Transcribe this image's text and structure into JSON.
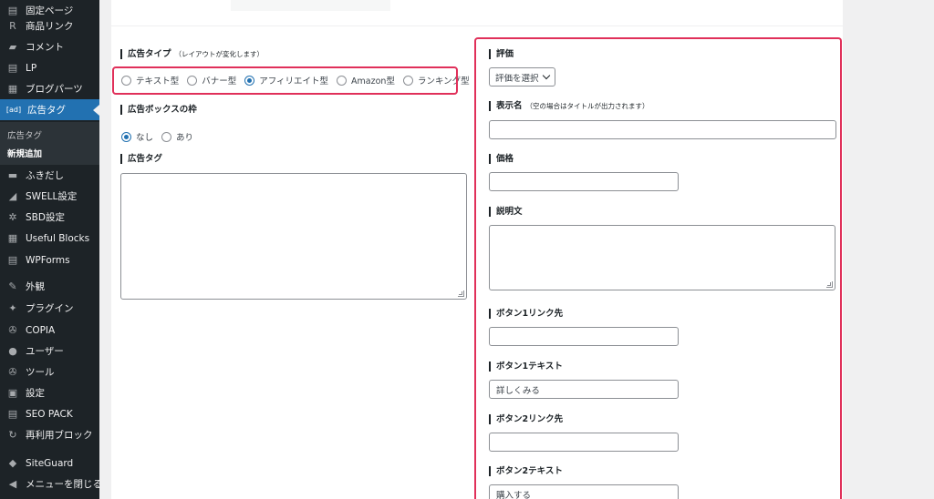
{
  "sidebar": {
    "items": [
      {
        "icon": "page-icon",
        "glyph": "▤",
        "label": "固定ページ"
      },
      {
        "icon": "r-icon",
        "glyph": "R",
        "label": "商品リンク"
      },
      {
        "icon": "comment-icon",
        "glyph": "▰",
        "label": "コメント"
      },
      {
        "icon": "page-icon",
        "glyph": "▤",
        "label": "LP"
      },
      {
        "icon": "layout-icon",
        "glyph": "▦",
        "label": "ブログパーツ"
      },
      {
        "icon": "ad-icon",
        "glyph": "[ad]",
        "label": "広告タグ"
      },
      {
        "icon": "speech-bubble-icon",
        "glyph": "▬",
        "label": "ふきだし"
      },
      {
        "icon": "swell-icon",
        "glyph": "◢",
        "label": "SWELL設定"
      },
      {
        "icon": "gear-icon",
        "glyph": "✲",
        "label": "SBD設定"
      },
      {
        "icon": "grid-icon",
        "glyph": "▦",
        "label": "Useful Blocks"
      },
      {
        "icon": "form-icon",
        "glyph": "▤",
        "label": "WPForms"
      },
      {
        "icon": "brush-icon",
        "glyph": "✎",
        "label": "外観"
      },
      {
        "icon": "plugin-icon",
        "glyph": "✦",
        "label": "プラグイン"
      },
      {
        "icon": "wrench-icon",
        "glyph": "✇",
        "label": "COPIA"
      },
      {
        "icon": "user-icon",
        "glyph": "●",
        "label": "ユーザー"
      },
      {
        "icon": "wrench-icon",
        "glyph": "✇",
        "label": "ツール"
      },
      {
        "icon": "settings-icon",
        "glyph": "▣",
        "label": "設定"
      },
      {
        "icon": "seo-icon",
        "glyph": "▤",
        "label": "SEO PACK"
      },
      {
        "icon": "reload-icon",
        "glyph": "↻",
        "label": "再利用ブロック"
      },
      {
        "icon": "shield-icon",
        "glyph": "◆",
        "label": "SiteGuard"
      },
      {
        "icon": "collapse-icon",
        "glyph": "◀",
        "label": "メニューを閉じる"
      }
    ],
    "submenu": [
      "広告タグ",
      "新規追加"
    ]
  },
  "left": {
    "ad_type_label": "広告タイプ",
    "ad_type_note": "（レイアウトが変化します）",
    "ad_types": [
      "テキスト型",
      "バナー型",
      "アフィリエイト型",
      "Amazon型",
      "ランキング型"
    ],
    "ad_type_selected": "アフィリエイト型",
    "frame_label": "広告ボックスの枠",
    "frame_options": [
      "なし",
      "あり"
    ],
    "frame_selected": "なし",
    "tag_label": "広告タグ"
  },
  "right": {
    "rating_label": "評価",
    "rating_select": "評価を選択",
    "display_name_label": "表示名",
    "display_name_note": "（空の場合はタイトルが出力されます）",
    "price_label": "価格",
    "description_label": "説明文",
    "button1_link_label": "ボタン1リンク先",
    "button1_text_label": "ボタン1テキスト",
    "button1_text_value": "詳しくみる",
    "button2_link_label": "ボタン2リンク先",
    "button2_text_label": "ボタン2テキスト",
    "button2_text_value": "購入する"
  },
  "colors": {
    "highlight": "#e0305a",
    "accent": "#2271b1",
    "sidebar": "#1d2327"
  }
}
